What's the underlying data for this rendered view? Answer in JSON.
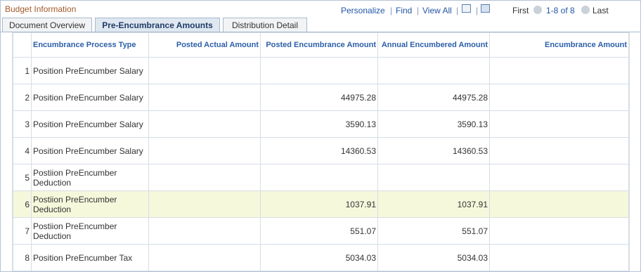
{
  "header": {
    "title": "Budget Information"
  },
  "nav": {
    "personalize": "Personalize",
    "find": "Find",
    "view_all": "View All",
    "first": "First",
    "range": "1-8 of 8",
    "last": "Last"
  },
  "tabs": [
    {
      "label": "Document Overview",
      "active": false
    },
    {
      "label": "Pre-Encumbrance Amounts",
      "active": true
    },
    {
      "label": "Distribution Detail",
      "active": false
    }
  ],
  "table": {
    "columns": [
      "Encumbrance Process Type",
      "Posted Actual Amount",
      "Posted Encumbrance Amount",
      "Annual Encumbered Amount",
      "Encumbrance Amount"
    ],
    "rows": [
      {
        "n": "1",
        "type": "Position PreEncumber Salary",
        "posted_actual": "",
        "posted_enc": "",
        "annual": "",
        "enc": ""
      },
      {
        "n": "2",
        "type": "Position PreEncumber Salary",
        "posted_actual": "",
        "posted_enc": "44975.28",
        "annual": "44975.28",
        "enc": ""
      },
      {
        "n": "3",
        "type": "Position PreEncumber Salary",
        "posted_actual": "",
        "posted_enc": "3590.13",
        "annual": "3590.13",
        "enc": ""
      },
      {
        "n": "4",
        "type": "Position PreEncumber Salary",
        "posted_actual": "",
        "posted_enc": "14360.53",
        "annual": "14360.53",
        "enc": ""
      },
      {
        "n": "5",
        "type": "Postiion PreEncumber Deduction",
        "posted_actual": "",
        "posted_enc": "",
        "annual": "",
        "enc": ""
      },
      {
        "n": "6",
        "type": "Postiion PreEncumber Deduction",
        "posted_actual": "",
        "posted_enc": "1037.91",
        "annual": "1037.91",
        "enc": ""
      },
      {
        "n": "7",
        "type": "Postiion PreEncumber Deduction",
        "posted_actual": "",
        "posted_enc": "551.07",
        "annual": "551.07",
        "enc": ""
      },
      {
        "n": "8",
        "type": "Position PreEncumber Tax",
        "posted_actual": "",
        "posted_enc": "5034.03",
        "annual": "5034.03",
        "enc": ""
      }
    ],
    "highlighted_row": 6
  },
  "icons": [
    "zoom-grid-icon",
    "download-grid-icon",
    "previous-icon",
    "next-icon",
    "tab-grid-icon"
  ],
  "colors": {
    "title": "#a35a2a",
    "link": "#2255a4",
    "header_text": "#2c5fa8",
    "highlight": "#f6f8dc"
  }
}
